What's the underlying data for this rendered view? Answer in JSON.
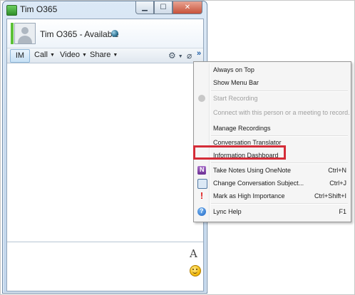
{
  "window": {
    "title": "Tim O365",
    "caption_buttons": {
      "minimize": "▁",
      "maximize": "☐",
      "close": "✕"
    }
  },
  "contact": {
    "display": "Tim O365 - Available",
    "presence_color": "#5cc139"
  },
  "toolbar": {
    "im_label": "IM",
    "call_label": "Call",
    "video_label": "Video",
    "share_label": "Share",
    "caret": "▼",
    "more_glyph": "»",
    "people_options_icon": "people-options-icon",
    "attach_icon": "paperclip-icon"
  },
  "compose": {
    "font_glyph": "A"
  },
  "menu": {
    "items": [
      {
        "label": "Always on Top",
        "shortcut": ""
      },
      {
        "label": "Show Menu Bar",
        "shortcut": ""
      },
      {
        "label": "Start Recording",
        "shortcut": "",
        "disabled": true
      },
      {
        "label": "Connect with this person or a meeting to record.",
        "shortcut": "",
        "disabled": true
      },
      {
        "label": "Manage Recordings",
        "shortcut": ""
      },
      {
        "label": "Conversation Translator",
        "shortcut": ""
      },
      {
        "label": "Information Dashboard",
        "shortcut": ""
      },
      {
        "label": "Take Notes Using OneNote",
        "shortcut": "Ctrl+N"
      },
      {
        "label": "Change Conversation Subject...",
        "shortcut": "Ctrl+J"
      },
      {
        "label": "Mark as High Importance",
        "shortcut": "Ctrl+Shift+I"
      },
      {
        "label": "Lync Help",
        "shortcut": "F1"
      }
    ],
    "highlight_color": "#d42d38"
  }
}
